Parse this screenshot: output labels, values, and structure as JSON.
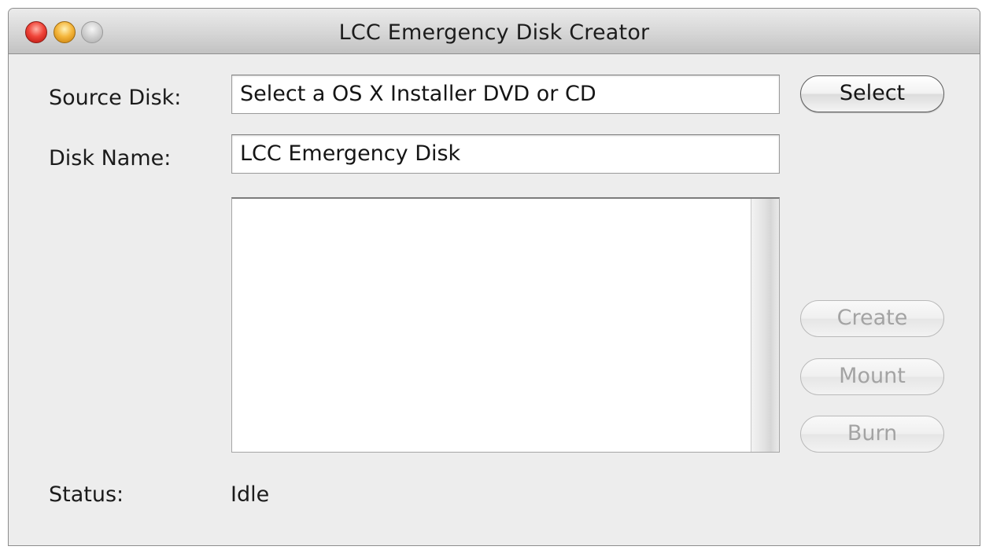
{
  "window": {
    "title": "LCC Emergency Disk Creator",
    "controls": {
      "close": "close-button",
      "minimize": "minimize-button",
      "zoom": "zoom-button"
    }
  },
  "form": {
    "source_disk": {
      "label": "Source Disk:",
      "value": "Select a OS X Installer DVD or CD"
    },
    "disk_name": {
      "label": "Disk Name:",
      "value": "LCC Emergency Disk"
    }
  },
  "buttons": {
    "select": "Select",
    "create": "Create",
    "mount": "Mount",
    "burn": "Burn"
  },
  "status": {
    "label": "Status:",
    "value": "Idle"
  },
  "log": {
    "items": []
  }
}
